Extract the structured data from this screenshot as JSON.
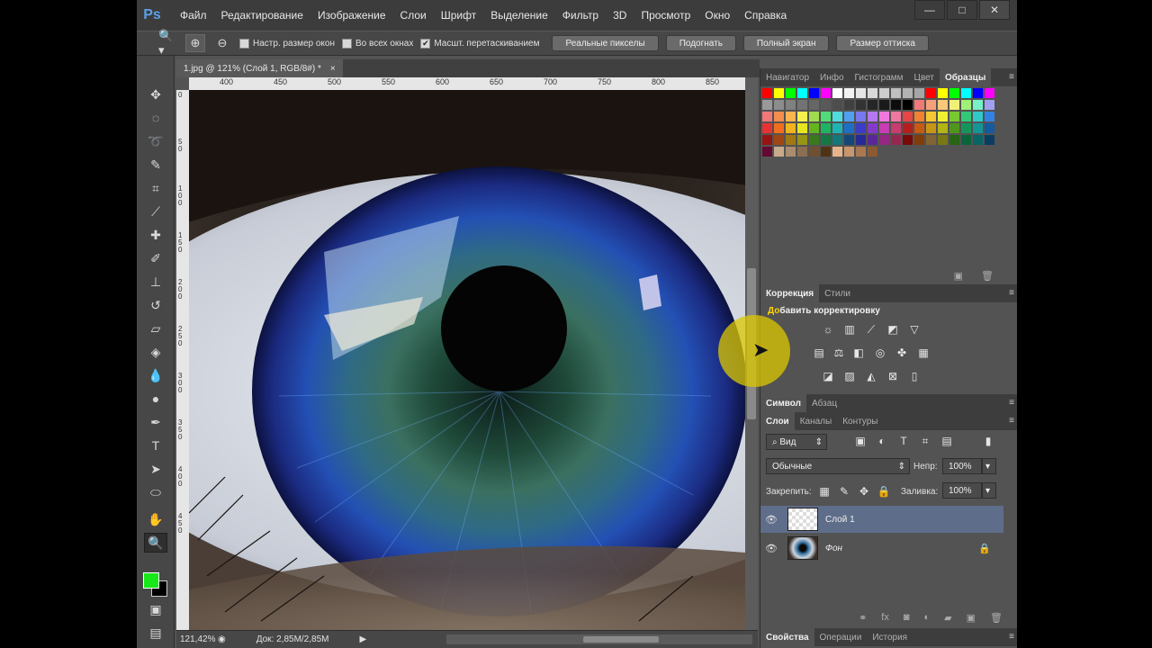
{
  "app": {
    "logo": "Ps",
    "menu": [
      "Файл",
      "Редактирование",
      "Изображение",
      "Слои",
      "Шрифт",
      "Выделение",
      "Фильтр",
      "3D",
      "Просмотр",
      "Окно",
      "Справка"
    ],
    "window_buttons": [
      "—",
      "□",
      "✕"
    ]
  },
  "options_bar": {
    "checkbox_resize": "Настр. размер окон",
    "checkbox_all_windows": "Во всех окнах",
    "checkbox_scrubby": "Масшт. перетаскиванием",
    "btn_actual_pixels": "Реальные пикселы",
    "btn_fit": "Подогнать",
    "btn_fill": "Полный экран",
    "btn_print": "Размер оттиска"
  },
  "document": {
    "tab_title": "1.jpg @ 121% (Слой 1, RGB/8#) *",
    "tab_close": "×",
    "ruler_h": [
      "400",
      "450",
      "500",
      "550",
      "600",
      "650",
      "700",
      "750",
      "800",
      "850"
    ],
    "ruler_v": [
      "0",
      "5 0",
      "1 0 0",
      "1 5 0",
      "2 0 0",
      "2 5 0",
      "3 0 0",
      "3 5 0",
      "4 0 0",
      "4 5 0"
    ]
  },
  "status": {
    "zoom": "121,42%",
    "doc_size": "Док: 2,85M/2,85M"
  },
  "panels": {
    "swatches_tabs": [
      "Навигатор",
      "Инфо",
      "Гистограмм",
      "Цвет",
      "Образцы"
    ],
    "swatches_active": "Образцы",
    "adjust_tabs": [
      "Коррекция",
      "Стили"
    ],
    "adjust_active": "Коррекция",
    "adjust_title_first": "До",
    "adjust_title_rest": "бавить корректировку",
    "char_tabs": [
      "Символ",
      "Абзац"
    ],
    "char_active": "Символ",
    "layers_tabs": [
      "Слои",
      "Каналы",
      "Контуры"
    ],
    "layers_active": "Слои",
    "filter_kind": "Вид",
    "blend_mode": "Обычные",
    "opacity_label": "Непр:",
    "opacity_value": "100%",
    "lock_label": "Закрепить:",
    "fill_label": "Заливка:",
    "fill_value": "100%",
    "layers": [
      {
        "name": "Слой 1",
        "selected": true
      },
      {
        "name": "Фон",
        "selected": false
      }
    ],
    "bottom_tabs": [
      "Свойства",
      "Операции",
      "История"
    ],
    "bottom_active": "Свойства"
  },
  "colors": {
    "foreground": "#18e818",
    "background": "#000000",
    "accent_highlight": "#dcc800"
  },
  "swatch_colors": [
    [
      "#ff0000",
      "#ffff00",
      "#00ff00",
      "#00ffff",
      "#0000ff",
      "#ff00ff",
      "#ffffff",
      "#f2f2f2",
      "#e6e6e6",
      "#d9d9d9",
      "#cccccc",
      "#bfbfbf",
      "#b3b3b3",
      "#a6a6a6",
      "#ff0000",
      "#ffff00",
      "#00ff00",
      "#00ffff",
      "#0000ff",
      "#ff00ff"
    ],
    [
      "#999999",
      "#8c8c8c",
      "#808080",
      "#737373",
      "#666666",
      "#595959",
      "#4d4d4d",
      "#404040",
      "#333333",
      "#262626",
      "#1a1a1a",
      "#0d0d0d",
      "#000000",
      "#f07878",
      "#f5a078",
      "#fac878",
      "#f0f078",
      "#a0f078",
      "#78f0c8",
      "#a0a0f0"
    ],
    [
      "#f07878",
      "#f58c50",
      "#fab450",
      "#f5f050",
      "#a0dc50",
      "#50dc78",
      "#50dcdc",
      "#50a0f0",
      "#7878f0",
      "#b478f0",
      "#f078dc",
      "#f078a0",
      "#e64646",
      "#f08232",
      "#f5c832",
      "#f0f032",
      "#78c832",
      "#32c878",
      "#32c8c8",
      "#3282e6"
    ],
    [
      "#e63232",
      "#f06e1e",
      "#f0b41e",
      "#e6e61e",
      "#64b41e",
      "#1eb464",
      "#1eb4b4",
      "#1e6ec8",
      "#3c3cc8",
      "#823cc8",
      "#c83cb4",
      "#c83c6e",
      "#b41e1e",
      "#c85a14",
      "#c89614",
      "#b4b414",
      "#50961e",
      "#14965a",
      "#149696",
      "#145aa0"
    ],
    [
      "#961414",
      "#a04614",
      "#a07814",
      "#969614",
      "#3c781e",
      "#147846",
      "#147878",
      "#144678",
      "#282896",
      "#5a2896",
      "#962882",
      "#962850",
      "#780a0a",
      "#823c0a",
      "#826432",
      "#787814",
      "#286414",
      "#0a643c",
      "#0a6464",
      "#0a3c64"
    ],
    [
      "#640a32",
      "#c8aa8c",
      "#aa8c6e",
      "#8c6e50",
      "#6e5032",
      "#503214",
      "#e6b48c",
      "#c8966e",
      "#aa7850",
      "#8c5a32"
    ]
  ]
}
